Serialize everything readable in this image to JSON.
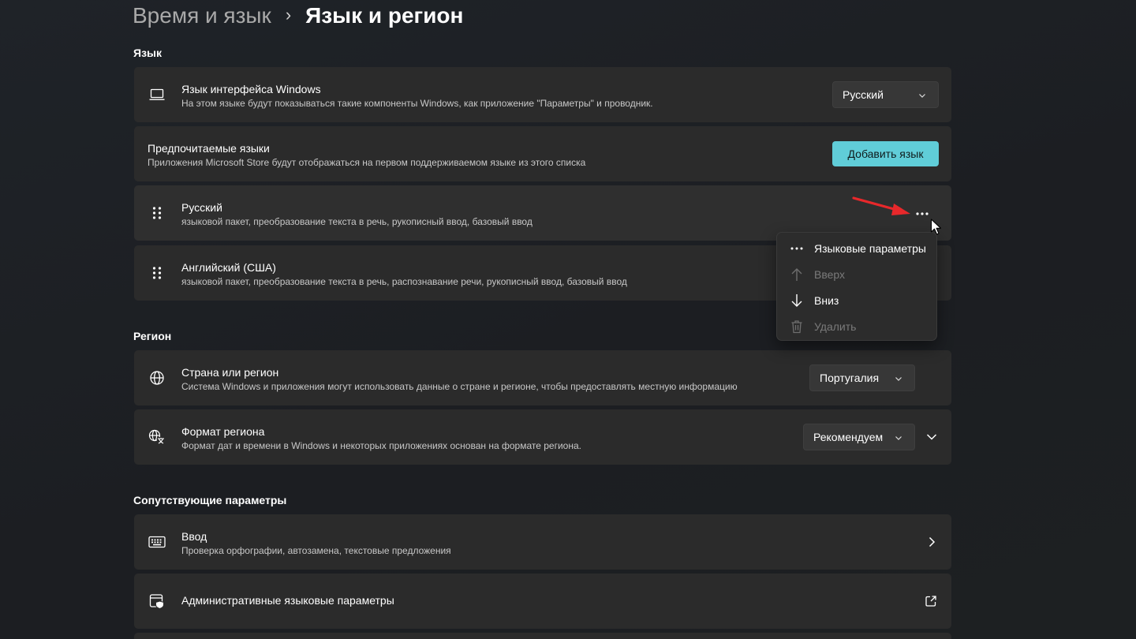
{
  "breadcrumb": {
    "parent": "Время и язык",
    "separator": "›",
    "current": "Язык и регион"
  },
  "sections": {
    "language": "Язык",
    "region": "Регион",
    "related": "Сопутствующие параметры"
  },
  "display_language": {
    "icon": "laptop-icon",
    "title": "Язык интерфейса Windows",
    "subtitle": "На этом языке будут показываться такие компоненты Windows, как приложение \"Параметры\" и проводник.",
    "value": "Русский"
  },
  "preferred_languages": {
    "title": "Предпочитаемые языки",
    "subtitle": "Приложения Microsoft Store будут отображаться на первом поддерживаемом языке из этого списка",
    "add_button": "Добавить язык"
  },
  "languages": [
    {
      "name": "Русский",
      "features": "языковой пакет, преобразование текста в речь, рукописный ввод, базовый ввод"
    },
    {
      "name": "Английский (США)",
      "features": "языковой пакет, преобразование текста в речь, распознавание речи, рукописный ввод, базовый ввод"
    }
  ],
  "context_menu": {
    "items": [
      {
        "icon": "more-icon",
        "label": "Языковые параметры",
        "enabled": true
      },
      {
        "icon": "arrow-up-icon",
        "label": "Вверх",
        "enabled": false
      },
      {
        "icon": "arrow-down-icon",
        "label": "Вниз",
        "enabled": true
      },
      {
        "icon": "trash-icon",
        "label": "Удалить",
        "enabled": false
      }
    ]
  },
  "country": {
    "icon": "globe-icon",
    "title": "Страна или регион",
    "subtitle": "Система Windows и приложения могут использовать данные о стране и регионе, чтобы предоставлять местную информацию",
    "value": "Португалия"
  },
  "regional_format": {
    "icon": "language-format-icon",
    "title": "Формат региона",
    "subtitle": "Формат дат и времени в Windows и некоторых приложениях основан на формате региона.",
    "value": "Рекомендуем"
  },
  "typing": {
    "icon": "keyboard-icon",
    "title": "Ввод",
    "subtitle": "Проверка орфографии, автозамена, текстовые предложения"
  },
  "admin_language": {
    "icon": "admin-shield-icon",
    "title": "Административные языковые параметры"
  },
  "colors": {
    "accent": "#60cdd8",
    "card": "#2b2b2b",
    "annotation_arrow": "#e8282b"
  }
}
